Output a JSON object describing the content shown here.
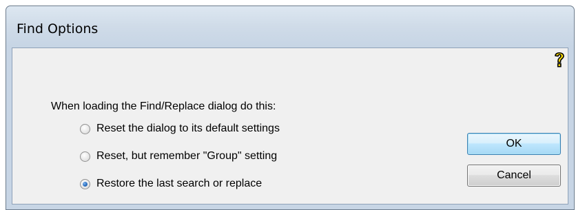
{
  "dialog": {
    "title": "Find Options",
    "help_icon": "help-question-icon",
    "prompt": "When loading the Find/Replace dialog do this:",
    "options": [
      {
        "label": "Reset the dialog to its default settings",
        "checked": false
      },
      {
        "label": "Reset, but remember \"Group\" setting",
        "checked": false
      },
      {
        "label": "Restore the last search or replace",
        "checked": true
      }
    ],
    "ok_label": "OK",
    "cancel_label": "Cancel"
  },
  "colors": {
    "frame": "#cfdbe8",
    "client_background": "#f0f0f0",
    "help_icon_fill": "#ffe000",
    "ok_border": "#3c7fb1",
    "radio_selected": "#2c6fc0"
  }
}
